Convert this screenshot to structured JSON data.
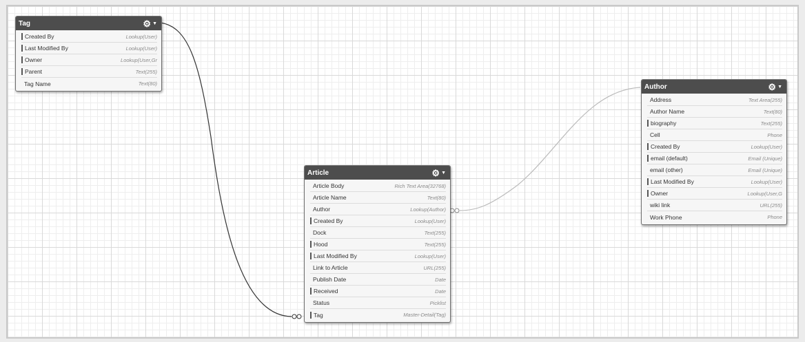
{
  "entities": {
    "tag": {
      "title": "Tag",
      "fields": [
        {
          "name": "Created By",
          "type": "Lookup(User)",
          "ref": true
        },
        {
          "name": "Last Modified By",
          "type": "Lookup(User)",
          "ref": true
        },
        {
          "name": "Owner",
          "type": "Lookup(User,Gr",
          "ref": true
        },
        {
          "name": "Parent",
          "type": "Text(255)",
          "ref": true
        },
        {
          "name": "Tag Name",
          "type": "Text(80)",
          "ref": false
        }
      ]
    },
    "article": {
      "title": "Article",
      "fields": [
        {
          "name": "Article Body",
          "type": "Rich Text Area(32768)",
          "ref": false
        },
        {
          "name": "Article Name",
          "type": "Text(80)",
          "ref": false
        },
        {
          "name": "Author",
          "type": "Lookup(Author)",
          "ref": false
        },
        {
          "name": "Created By",
          "type": "Lookup(User)",
          "ref": true
        },
        {
          "name": "Dock",
          "type": "Text(255)",
          "ref": false
        },
        {
          "name": "Hood",
          "type": "Text(255)",
          "ref": true
        },
        {
          "name": "Last Modified By",
          "type": "Lookup(User)",
          "ref": true
        },
        {
          "name": "Link to Article",
          "type": "URL(255)",
          "ref": false
        },
        {
          "name": "Publish Date",
          "type": "Date",
          "ref": false
        },
        {
          "name": "Received",
          "type": "Date",
          "ref": true
        },
        {
          "name": "Status",
          "type": "Picklist",
          "ref": false
        },
        {
          "name": "Tag",
          "type": "Master-Detail(Tag)",
          "ref": true
        }
      ]
    },
    "author": {
      "title": "Author",
      "fields": [
        {
          "name": "Address",
          "type": "Text Area(255)",
          "ref": false
        },
        {
          "name": "Author Name",
          "type": "Text(80)",
          "ref": false
        },
        {
          "name": "biography",
          "type": "Text(255)",
          "ref": true
        },
        {
          "name": "Cell",
          "type": "Phone",
          "ref": false
        },
        {
          "name": "Created By",
          "type": "Lookup(User)",
          "ref": true
        },
        {
          "name": "email (default)",
          "type": "Email (Unique)",
          "ref": true
        },
        {
          "name": "email (other)",
          "type": "Email (Unique)",
          "ref": false
        },
        {
          "name": "Last Modified By",
          "type": "Lookup(User)",
          "ref": true
        },
        {
          "name": "Owner",
          "type": "Lookup(User,G",
          "ref": true
        },
        {
          "name": "wiki link",
          "type": "URL(255)",
          "ref": false
        },
        {
          "name": "Work Phone",
          "type": "Phone",
          "ref": false
        }
      ]
    }
  },
  "icons": {
    "gear": "gear-icon",
    "dropdown": "chevron-down-icon"
  },
  "colors": {
    "header": "#4d4d4d",
    "link_dark": "#333333",
    "link_light": "#bbbbbb"
  }
}
